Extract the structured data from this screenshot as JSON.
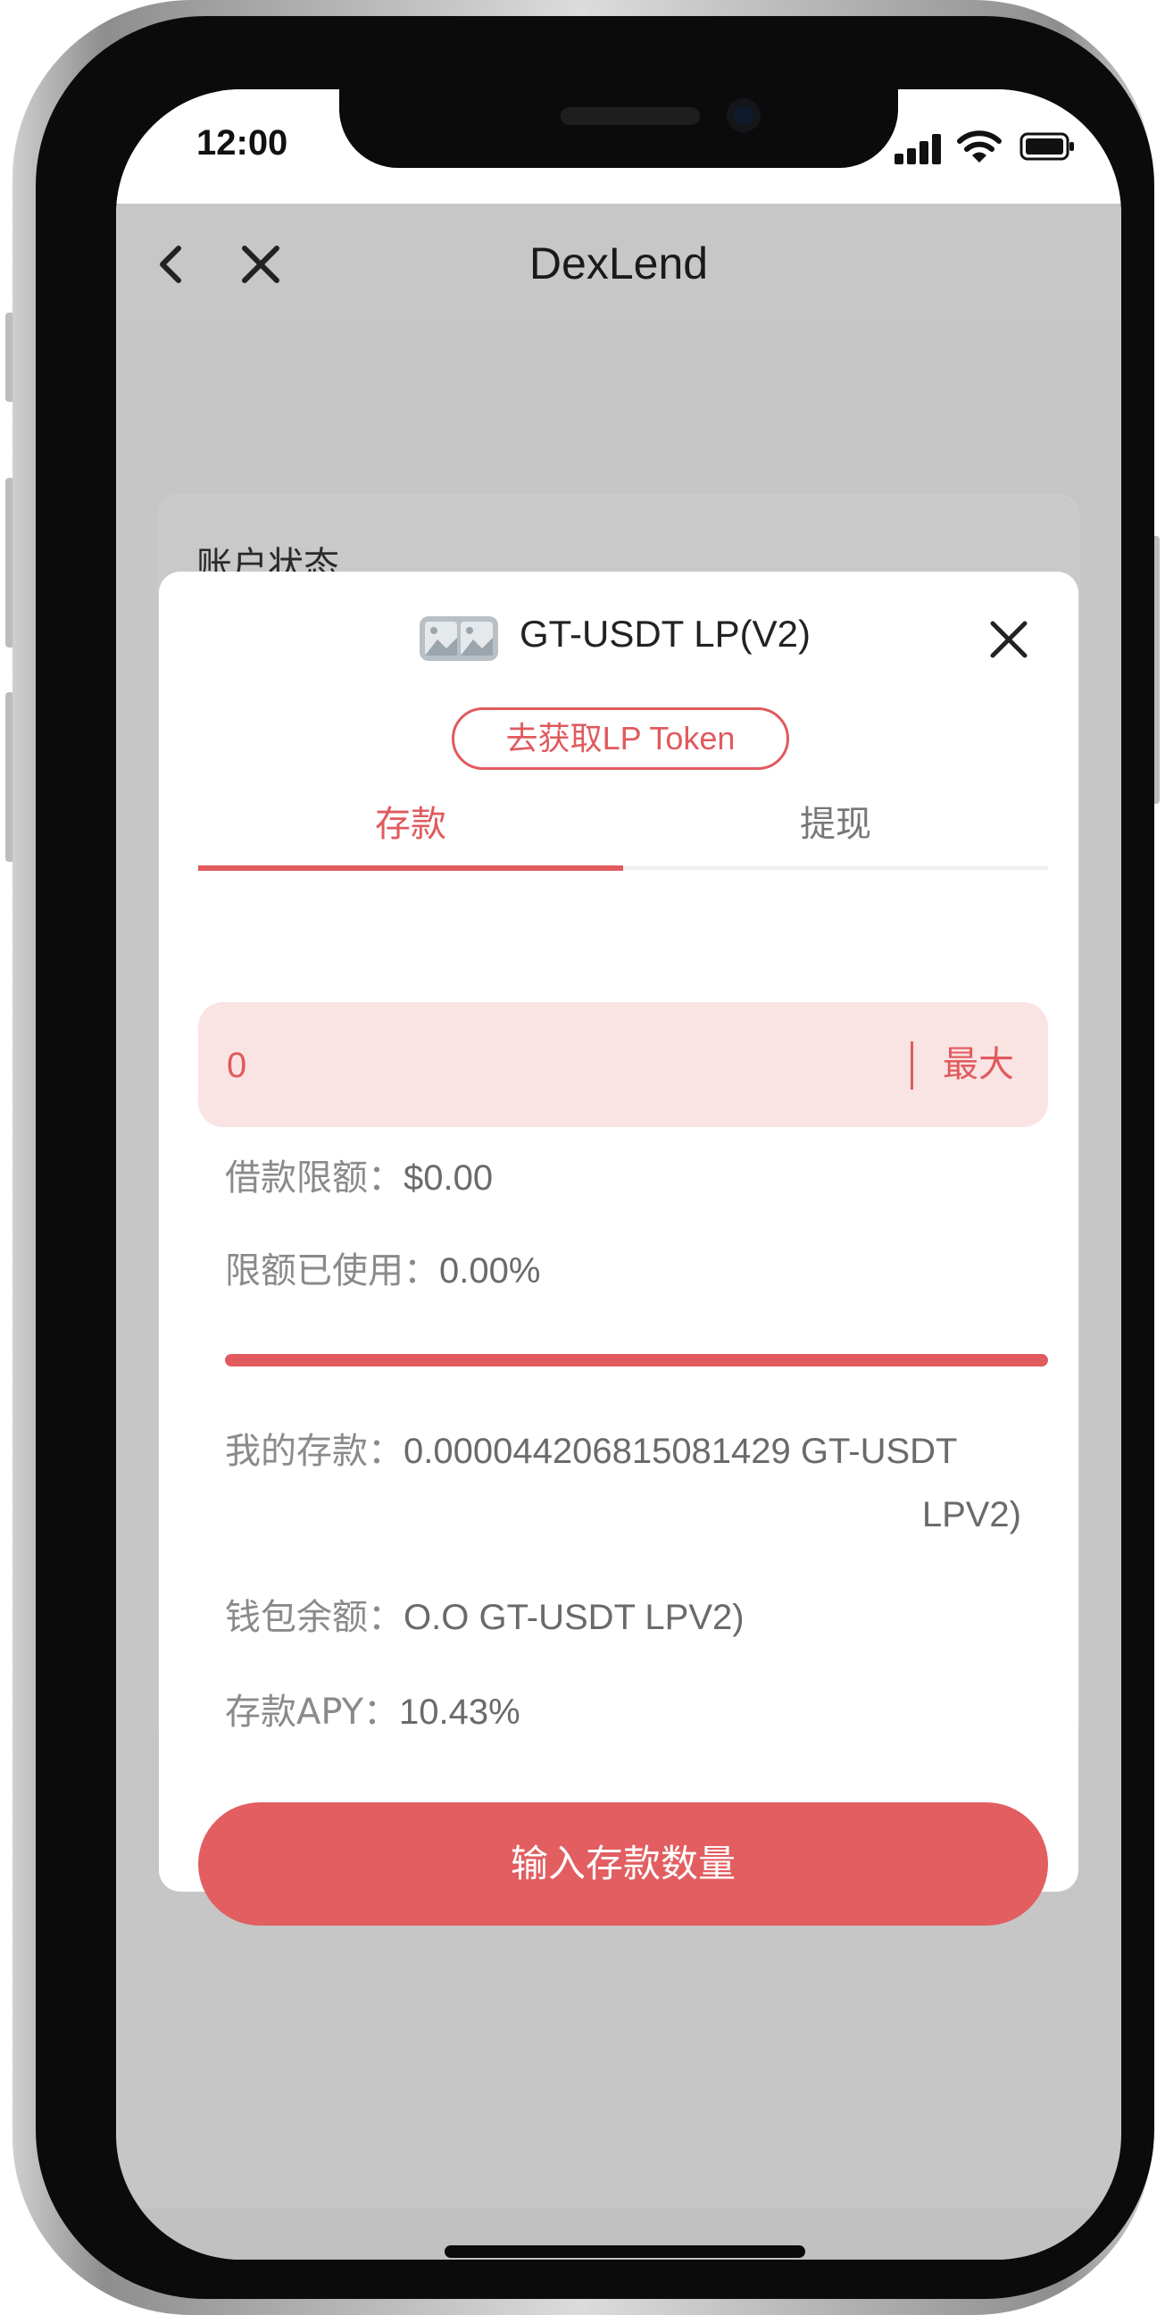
{
  "status_bar": {
    "time": "12:00"
  },
  "header": {
    "title": "DexLend",
    "back_icon": "chevron-left-icon",
    "close_icon": "close-icon"
  },
  "background_card": {
    "title": "账户状态"
  },
  "modal": {
    "token_icon": "image-placeholder-icon",
    "token_name": "GT-USDT LP(V2)",
    "get_lp_label": "去获取LP Token",
    "tabs": [
      {
        "label": "存款",
        "active": true
      },
      {
        "label": "提现",
        "active": false
      }
    ],
    "amount": {
      "placeholder": "0",
      "max_label": "最大"
    },
    "borrow_limit": {
      "label": "借款限额：",
      "value": "$0.00"
    },
    "limit_used": {
      "label": "限额已使用：",
      "value": "0.00%"
    },
    "limit_used_fraction": 1.0,
    "my_deposit": {
      "label": "我的存款：",
      "value_line1": "0.000044206815081429 GT-USDT",
      "value_line2": "LPV2)"
    },
    "wallet_balance": {
      "label": "钱包余额：",
      "value": "O.O GT-USDT LPV2)"
    },
    "deposit_apy": {
      "label": "存款APY：",
      "value": "10.43%"
    },
    "submit_label": "输入存款数量"
  },
  "colors": {
    "accent": "#e05a5e",
    "accent_light": "#fae3e3",
    "overlay": "#c6c6c6"
  }
}
